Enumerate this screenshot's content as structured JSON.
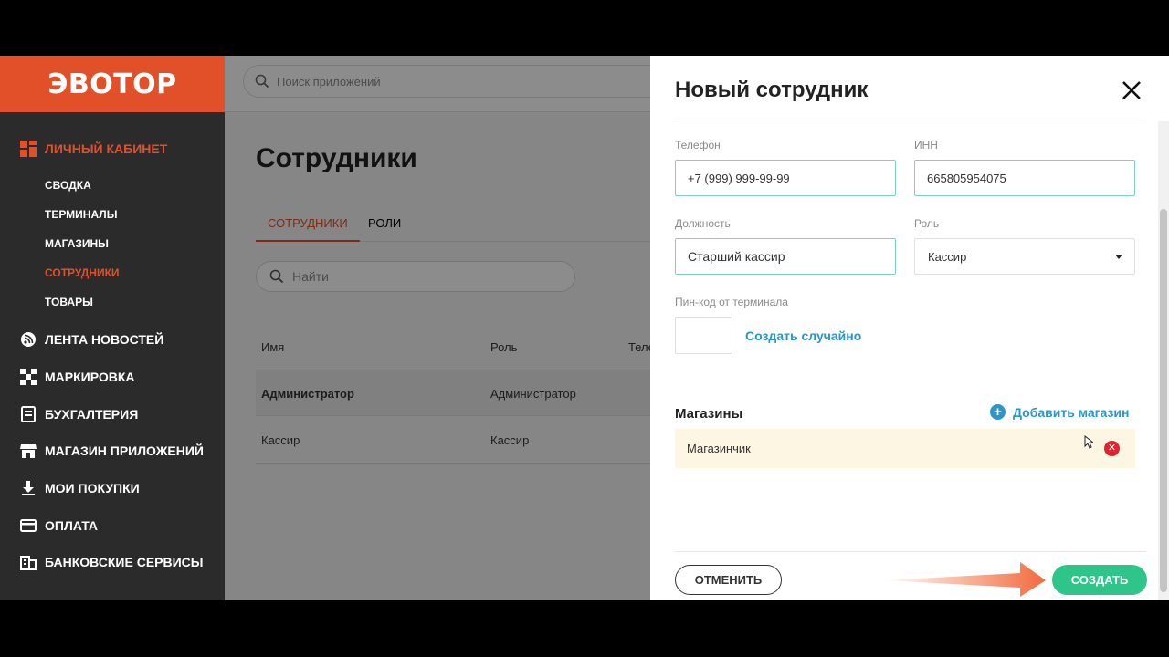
{
  "sidebar": {
    "logo": "ЭВОТОР",
    "cabinet": "ЛИЧНЫЙ КАБИНЕТ",
    "sub": [
      "СВОДКА",
      "ТЕРМИНАЛЫ",
      "МАГАЗИНЫ",
      "СОТРУДНИКИ",
      "ТОВАРЫ"
    ],
    "items": [
      "ЛЕНТА НОВОСТЕЙ",
      "МАРКИРОВКА",
      "БУХГАЛТЕРИЯ",
      "МАГАЗИН ПРИЛОЖЕНИЙ",
      "МОИ ПОКУПКИ",
      "ОПЛАТА",
      "БАНКОВСКИЕ СЕРВИСЫ"
    ]
  },
  "topbar": {
    "search_placeholder": "Поиск приложений"
  },
  "main": {
    "title": "Сотрудники",
    "tabs": [
      "СОТРУДНИКИ",
      "РОЛИ"
    ],
    "search_placeholder": "Найти",
    "columns": [
      "Имя",
      "Роль",
      "Теле"
    ],
    "rows": [
      {
        "name": "Администратор",
        "role": "Администратор"
      },
      {
        "name": "Кассир",
        "role": "Кассир"
      }
    ]
  },
  "panel": {
    "title": "Новый сотрудник",
    "phone_label": "Телефон",
    "phone_value": "+7 (999) 999-99-99",
    "inn_label": "ИНН",
    "inn_value": "665805954075",
    "position_label": "Должность",
    "position_value": "Старший кассир",
    "role_label": "Роль",
    "role_value": "Кассир",
    "pin_label": "Пин-код от терминала",
    "random_link": "Создать случайно",
    "stores_title": "Магазины",
    "add_store": "Добавить магазин",
    "store_name": "Магазинчик",
    "cancel": "ОТМЕНИТЬ",
    "create": "СОЗДАТЬ"
  },
  "colors": {
    "brand": "#e2502a",
    "accent_green": "#2ec48a",
    "link_blue": "#2a96c9",
    "danger": "#e0242f"
  }
}
